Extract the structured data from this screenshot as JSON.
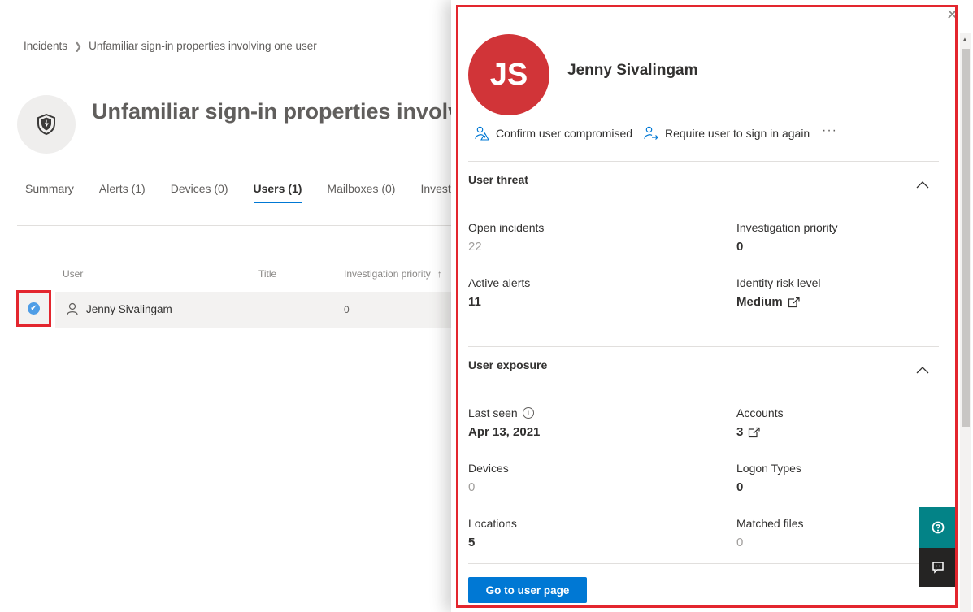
{
  "breadcrumb": {
    "root": "Incidents",
    "current": "Unfamiliar sign-in properties involving one user"
  },
  "page": {
    "title": "Unfamiliar sign-in properties involving one user"
  },
  "tabs": [
    {
      "label": "Summary"
    },
    {
      "label": "Alerts (1)"
    },
    {
      "label": "Devices (0)"
    },
    {
      "label": "Users (1)",
      "active": true
    },
    {
      "label": "Mailboxes (0)"
    },
    {
      "label": "Investigations"
    }
  ],
  "table": {
    "headers": {
      "user": "User",
      "title": "Title",
      "priority": "Investigation priority"
    },
    "rows": [
      {
        "user": "Jenny Sivalingam",
        "title": "",
        "priority": "0",
        "selected": true
      }
    ]
  },
  "panel": {
    "initials": "JS",
    "name": "Jenny Sivalingam",
    "avatar_color": "#d13438",
    "actions": {
      "confirm": "Confirm user compromised",
      "require": "Require user to sign in again",
      "more": "···"
    },
    "threat": {
      "title": "User threat",
      "open_incidents_label": "Open incidents",
      "open_incidents": "22",
      "investigation_priority_label": "Investigation priority",
      "investigation_priority": "0",
      "active_alerts_label": "Active alerts",
      "active_alerts": "11",
      "identity_risk_label": "Identity risk level",
      "identity_risk": "Medium"
    },
    "exposure": {
      "title": "User exposure",
      "last_seen_label": "Last seen",
      "last_seen": "Apr 13, 2021",
      "accounts_label": "Accounts",
      "accounts": "3",
      "devices_label": "Devices",
      "devices": "0",
      "logon_types_label": "Logon Types",
      "logon_types": "0",
      "locations_label": "Locations",
      "locations": "5",
      "matched_files_label": "Matched files",
      "matched_files": "0"
    },
    "primary_button": "Go to user page"
  },
  "colors": {
    "accent": "#0078d4",
    "highlight": "#e3262e",
    "help": "#038387"
  }
}
